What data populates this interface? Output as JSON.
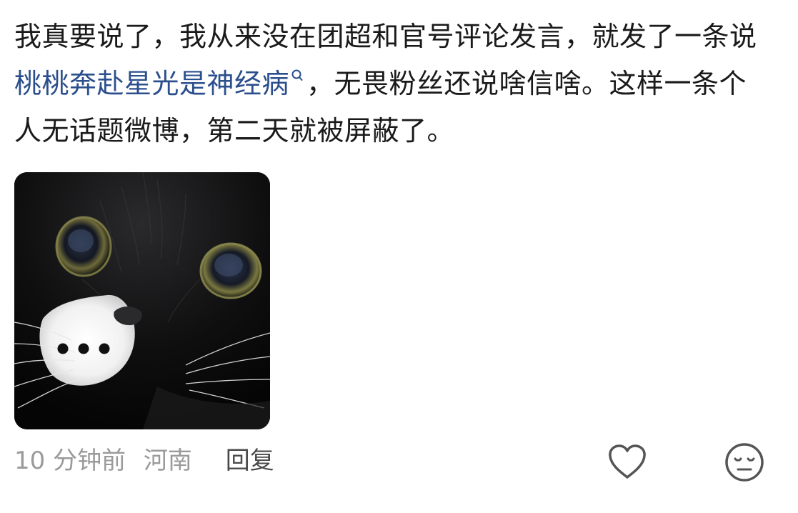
{
  "comment": {
    "text_before": "我真要说了，我从来没在团超和官号评论发言，就发了一条说 ",
    "topic_link": "桃桃奔赴星光是神经病",
    "topic_link_icon": "search-icon",
    "text_after": "，无畏粉丝还说啥信啥。这样一条个人无话题微博，第二天就被屏蔽了。"
  },
  "image": {
    "description_icon": "cat-photo",
    "ellipsis": "•••"
  },
  "meta": {
    "time": "10 分钟前",
    "location": "河南",
    "reply_label": "回复"
  },
  "actions": {
    "like_icon": "heart-icon",
    "emoji_icon": "neutral-face-icon"
  },
  "colors": {
    "link": "#2b4f8c",
    "meta": "#9a9a9a",
    "text": "#1a1a1a",
    "icon": "#555555"
  }
}
